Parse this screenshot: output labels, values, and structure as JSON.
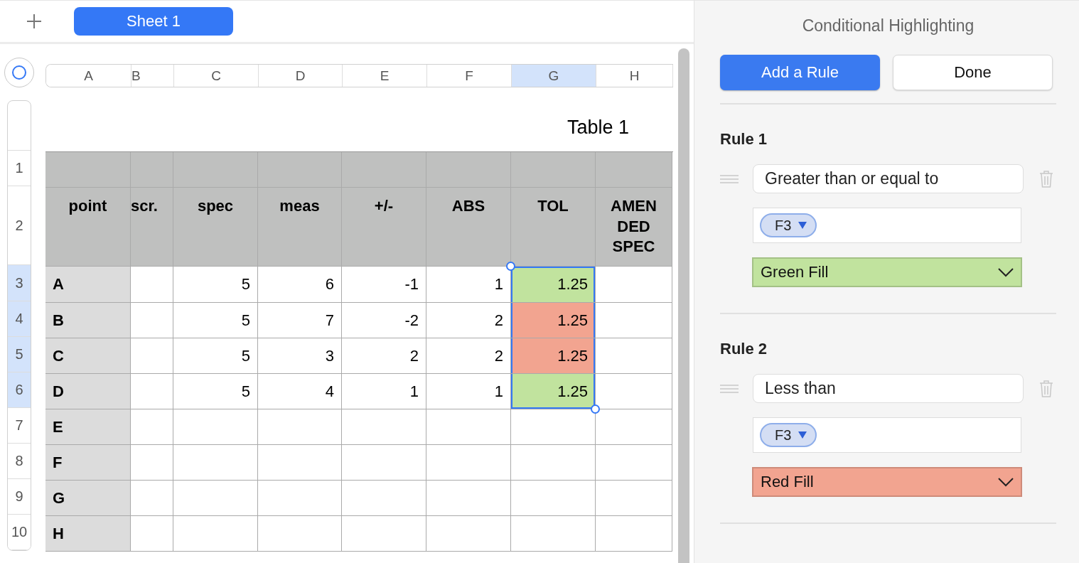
{
  "sheet_tabs": [
    {
      "label": "Sheet 1",
      "selected": true
    }
  ],
  "columns": [
    {
      "label": "A",
      "selected": false
    },
    {
      "label": "B",
      "selected": false
    },
    {
      "label": "C",
      "selected": false
    },
    {
      "label": "D",
      "selected": false
    },
    {
      "label": "E",
      "selected": false
    },
    {
      "label": "F",
      "selected": false
    },
    {
      "label": "G",
      "selected": true
    },
    {
      "label": "H",
      "selected": false
    }
  ],
  "row_numbers": [
    {
      "label": "1",
      "selected": false
    },
    {
      "label": "2",
      "selected": false
    },
    {
      "label": "3",
      "selected": true
    },
    {
      "label": "4",
      "selected": true
    },
    {
      "label": "5",
      "selected": true
    },
    {
      "label": "6",
      "selected": true
    },
    {
      "label": "7",
      "selected": false
    },
    {
      "label": "8",
      "selected": false
    },
    {
      "label": "9",
      "selected": false
    },
    {
      "label": "10",
      "selected": false
    }
  ],
  "table": {
    "title": "Table 1",
    "headers": [
      "point",
      "scr.",
      "spec",
      "meas",
      "+/-",
      "ABS",
      "TOL",
      "AMEN DED SPEC"
    ],
    "rows": [
      {
        "point": "A",
        "spec": "5",
        "meas": "6",
        "diff": "-1",
        "abs": "1",
        "tol": "1.25",
        "color": "#c1e39e",
        "tol_selected": true
      },
      {
        "point": "B",
        "spec": "5",
        "meas": "7",
        "diff": "-2",
        "abs": "2",
        "tol": "1.25",
        "color": "#f2a490",
        "tol_selected": true
      },
      {
        "point": "C",
        "spec": "5",
        "meas": "3",
        "diff": "2",
        "abs": "2",
        "tol": "1.25",
        "color": "#f2a490",
        "tol_selected": true
      },
      {
        "point": "D",
        "spec": "5",
        "meas": "4",
        "diff": "1",
        "abs": "1",
        "tol": "1.25",
        "color": "#c1e39e",
        "tol_selected": true
      },
      {
        "point": "E",
        "tol_selected": false
      },
      {
        "point": "F",
        "tol_selected": false
      },
      {
        "point": "G",
        "tol_selected": false
      },
      {
        "point": "H",
        "tol_selected": false
      }
    ]
  },
  "panel": {
    "title": "Conditional Highlighting",
    "buttons": [
      {
        "label": "Add a Rule",
        "kind": "primary"
      },
      {
        "label": "Done",
        "kind": "secondary"
      }
    ],
    "rules": [
      {
        "title": "Rule 1",
        "condition": "Greater than or equal to",
        "token": "F3",
        "style": "Green Fill",
        "color": "#c1e39e"
      },
      {
        "title": "Rule 2",
        "condition": "Less than",
        "token": "F3",
        "style": "Red Fill",
        "color": "#f2a490"
      }
    ]
  }
}
